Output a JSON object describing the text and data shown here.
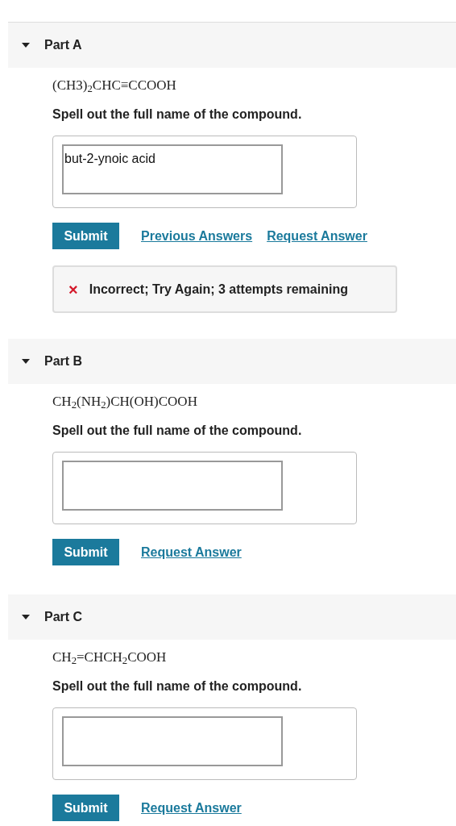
{
  "parts": [
    {
      "title": "Part A",
      "expanded": true,
      "formula": "(CH3)$_{2}$CHC≡CCOOH",
      "prompt": "Spell out the full name of the compound.",
      "answer": "but-2-ynoic acid",
      "submit": "Submit",
      "links": [
        "Previous Answers",
        "Request Answer"
      ],
      "feedback": {
        "mark": "×",
        "text": "Incorrect; Try Again; 3 attempts remaining"
      }
    },
    {
      "title": "Part B",
      "expanded": true,
      "formula": "CH$_{2}$(NH$_{2}$)CH(OH)COOH",
      "prompt": "Spell out the full name of the compound.",
      "submit": "Submit",
      "links": [
        "Request Answer"
      ]
    },
    {
      "title": "Part C",
      "expanded": true,
      "formula": "CH$_{2}$=CHCH$_{2}$COOH",
      "prompt": "Spell out the full name of the compound.",
      "submit": "Submit",
      "links": [
        "Request Answer"
      ]
    }
  ]
}
